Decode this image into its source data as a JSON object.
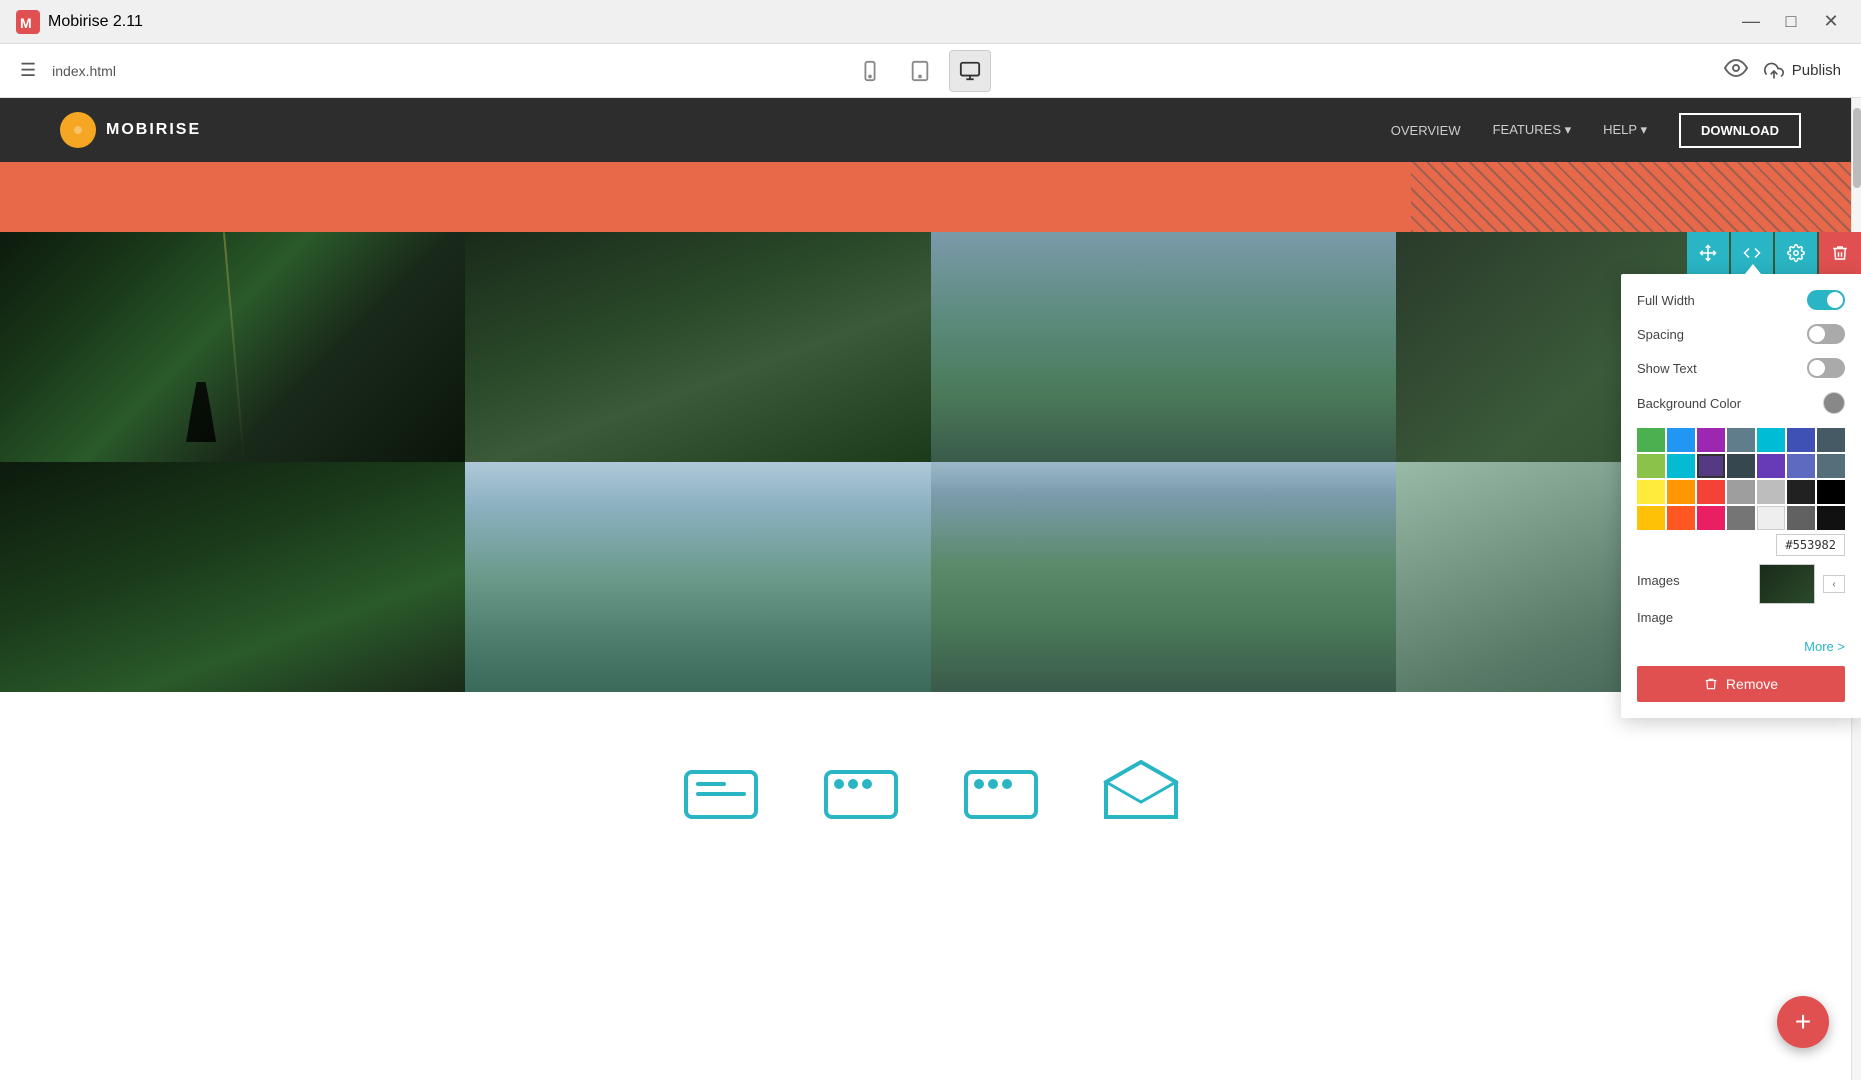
{
  "titleBar": {
    "appName": "Mobirise 2.11",
    "fileName": "index.html",
    "minBtn": "—",
    "maxBtn": "□",
    "closeBtn": "✕"
  },
  "toolbar": {
    "hamburgerLabel": "☰",
    "fileName": "index.html",
    "devices": [
      {
        "id": "mobile",
        "icon": "📱",
        "label": "mobile"
      },
      {
        "id": "tablet",
        "icon": "⬜",
        "label": "tablet"
      },
      {
        "id": "desktop",
        "icon": "🖥",
        "label": "desktop",
        "active": true
      }
    ],
    "publishLabel": "Publish",
    "publishIcon": "☁"
  },
  "siteNav": {
    "brand": "MOBIRISE",
    "links": [
      "OVERVIEW",
      "FEATURES ▾",
      "HELP ▾"
    ],
    "downloadBtn": "DOWNLOAD"
  },
  "galleryToolbar": {
    "arrowsIcon": "⇅",
    "codeIcon": "</>",
    "settingsIcon": "⚙",
    "deleteIcon": "🗑"
  },
  "settingsPanel": {
    "title": "Settings",
    "fullWidthLabel": "Full Width",
    "fullWidthOn": true,
    "spacingLabel": "Spacing",
    "spacingOn": false,
    "showTextLabel": "Show Text",
    "showTextOn": false,
    "bgColorLabel": "Background Color",
    "imagesLabel": "Images",
    "imageLabel": "Image",
    "moreLinkLabel": "More >",
    "removeLabel": "Remove",
    "colorHex": "#553982",
    "palette": [
      "#4caf50",
      "#2196f3",
      "#9c27b0",
      "#607d8b",
      "#8bc34a",
      "#03bcd4",
      "#3f51b5",
      "#455a64",
      "#cddc39",
      "#00bcd4",
      "#673ab7",
      "#37474f",
      "#ffeb3b",
      "#ff9800",
      "#f44336",
      "#9e9e9e",
      "#212121",
      "#ffc107",
      "#ff5722",
      "#e91e63",
      "#bdbdbd",
      "#000000"
    ]
  },
  "fab": {
    "icon": "+"
  }
}
